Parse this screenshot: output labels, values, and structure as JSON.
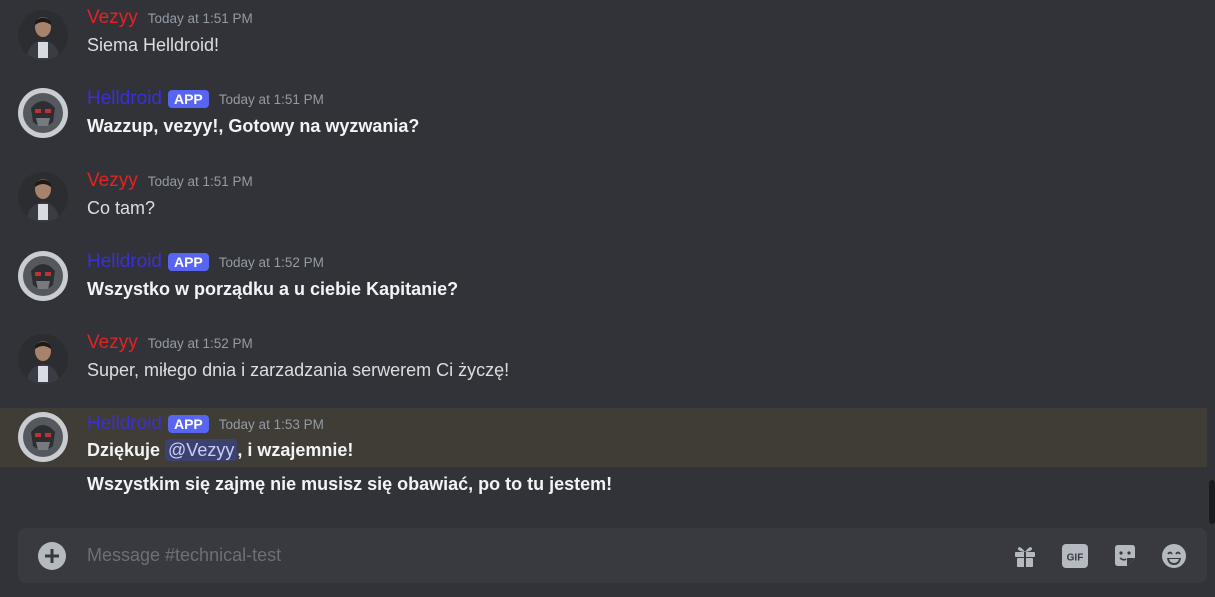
{
  "messages": [
    {
      "user": "Vezyy",
      "user_color": "#e12424",
      "time": "Today at 1:51 PM",
      "lines": [
        "Siema Helldroid!"
      ],
      "bot": false
    },
    {
      "user": "Helldroid",
      "user_color": "#3b2fd6",
      "tag": "APP",
      "time": "Today at 1:51 PM",
      "lines": [
        "Wazzup, vezyy!, Gotowy na wyzwania?"
      ],
      "bot": true
    },
    {
      "user": "Vezyy",
      "user_color": "#e12424",
      "time": "Today at 1:51 PM",
      "lines": [
        "Co tam?"
      ],
      "bot": false
    },
    {
      "user": "Helldroid",
      "user_color": "#3b2fd6",
      "tag": "APP",
      "time": "Today at 1:52 PM",
      "lines": [
        "Wszystko w porządku a u ciebie Kapitanie?"
      ],
      "bot": true
    },
    {
      "user": "Vezyy",
      "user_color": "#e12424",
      "time": "Today at 1:52 PM",
      "lines": [
        "Super, miłego dnia i zarzadzania serwerem Ci życzę!"
      ],
      "bot": false
    },
    {
      "user": "Helldroid",
      "user_color": "#3b2fd6",
      "tag": "APP",
      "time": "Today at 1:53 PM",
      "line1_prefix": "Dziękuje ",
      "mention": "@Vezyy",
      "line1_suffix": ", i wzajemnie!",
      "line2": "Wszystkim się zajmę nie musisz się obawiać, po to tu jestem!",
      "bot": true
    }
  ],
  "composer": {
    "placeholder": "Message #technical-test",
    "icons": [
      "plus-circle-icon",
      "gift-icon",
      "gif-icon",
      "sticker-icon",
      "emoji-icon"
    ],
    "gif_label": "GIF"
  }
}
